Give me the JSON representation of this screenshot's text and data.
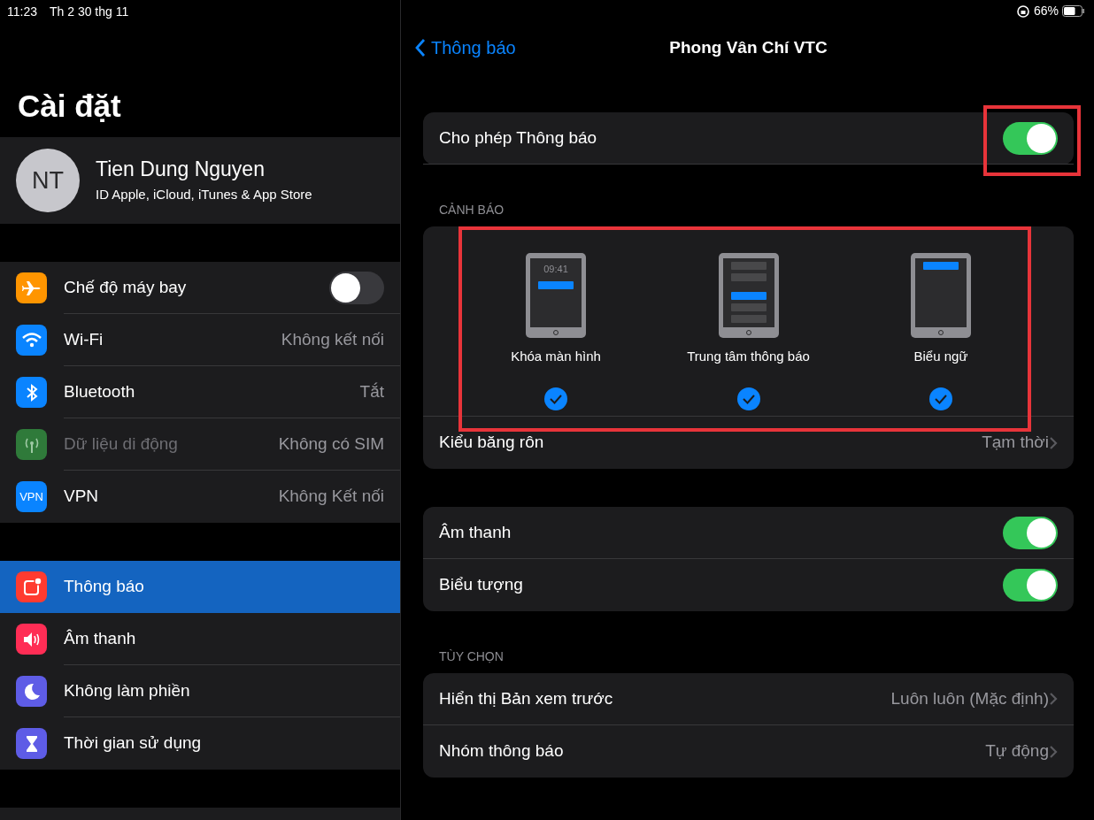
{
  "status_bar": {
    "time": "11:23",
    "date": "Th 2 30 thg 11",
    "battery": "66%"
  },
  "sidebar": {
    "title": "Cài đặt",
    "profile": {
      "initials": "NT",
      "name": "Tien Dung Nguyen",
      "subtitle": "ID Apple, iCloud, iTunes & App Store"
    },
    "groups": [
      [
        {
          "kind": "toggle",
          "label": "Chế độ máy bay",
          "on": false,
          "disabled": false,
          "selected": false
        },
        {
          "kind": "value",
          "label": "Wi-Fi",
          "value": "Không kết nối",
          "disabled": false,
          "selected": false
        },
        {
          "kind": "value",
          "label": "Bluetooth",
          "value": "Tắt",
          "disabled": false,
          "selected": false
        },
        {
          "kind": "value",
          "label": "Dữ liệu di động",
          "value": "Không có SIM",
          "disabled": true,
          "selected": false
        },
        {
          "kind": "value",
          "icon_text": "VPN",
          "label": "VPN",
          "value": "Không Kết nối",
          "disabled": false,
          "selected": false
        }
      ],
      [
        {
          "kind": "link",
          "label": "Thông báo",
          "disabled": false,
          "selected": true
        },
        {
          "kind": "link",
          "label": "Âm thanh",
          "disabled": false,
          "selected": false
        },
        {
          "kind": "link",
          "label": "Không làm phiền",
          "disabled": false,
          "selected": false
        },
        {
          "kind": "link",
          "label": "Thời gian sử dụng",
          "disabled": false,
          "selected": false
        }
      ]
    ]
  },
  "detail": {
    "back": "Thông báo",
    "title": "Phong Vân Chí VTC",
    "allow": {
      "label": "Cho phép Thông báo",
      "on": true,
      "highlighted": true
    },
    "alerts": {
      "header": "CẢNH BÁO",
      "highlighted": true,
      "styles": [
        {
          "kind": "lock",
          "label": "Khóa màn hình",
          "clock": "09:41",
          "checked": true
        },
        {
          "kind": "center",
          "label": "Trung tâm thông báo",
          "checked": true
        },
        {
          "kind": "banner",
          "label": "Biểu ngữ",
          "checked": true
        }
      ],
      "banner_row": {
        "label": "Kiểu băng rôn",
        "value": "Tạm thời"
      }
    },
    "toggles": [
      {
        "label": "Âm thanh",
        "on": true
      },
      {
        "label": "Biểu tượng",
        "on": true
      }
    ],
    "options": {
      "header": "TÙY CHỌN",
      "rows": [
        {
          "label": "Hiển thị Bản xem trước",
          "value": "Luôn luôn (Mặc định)"
        },
        {
          "label": "Nhóm thông báo",
          "value": "Tự động"
        }
      ]
    }
  }
}
